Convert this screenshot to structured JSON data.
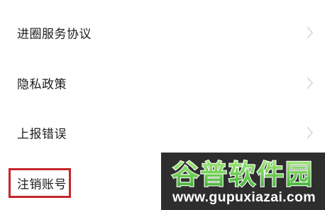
{
  "menu": {
    "items": [
      {
        "label": "进圈服务协议"
      },
      {
        "label": "隐私政策"
      },
      {
        "label": "上报错误"
      },
      {
        "label": "注销账号"
      }
    ]
  },
  "watermark": {
    "title": "谷普软件园",
    "url": "www.gupuxiazai.com"
  },
  "colors": {
    "highlight": "#c5272a",
    "watermark_green": "#3bbf2a"
  }
}
